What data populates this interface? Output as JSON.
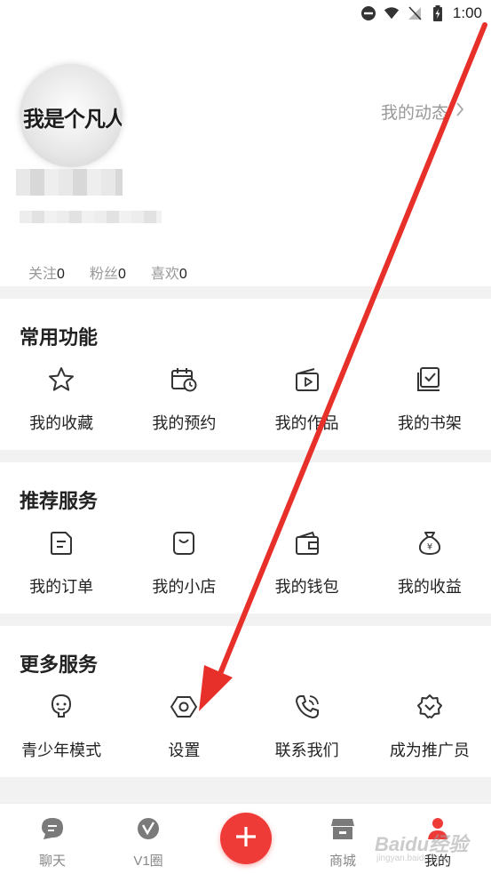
{
  "status_bar": {
    "time": "1:00"
  },
  "profile": {
    "avatar_text": "我是个凡人",
    "dynamics_link": "我的动态",
    "stats": [
      {
        "label": "关注",
        "value": "0"
      },
      {
        "label": "粉丝",
        "value": "0"
      },
      {
        "label": "喜欢",
        "value": "0"
      }
    ]
  },
  "sections": {
    "common": {
      "title": "常用功能",
      "items": [
        {
          "label": "我的收藏",
          "icon": "star-icon"
        },
        {
          "label": "我的预约",
          "icon": "calendar-clock-icon"
        },
        {
          "label": "我的作品",
          "icon": "video-folder-icon"
        },
        {
          "label": "我的书架",
          "icon": "bookshelf-icon"
        }
      ]
    },
    "recommended": {
      "title": "推荐服务",
      "items": [
        {
          "label": "我的订单",
          "icon": "order-icon"
        },
        {
          "label": "我的小店",
          "icon": "shop-bag-icon"
        },
        {
          "label": "我的钱包",
          "icon": "wallet-icon"
        },
        {
          "label": "我的收益",
          "icon": "money-bag-icon"
        }
      ]
    },
    "more": {
      "title": "更多服务",
      "items": [
        {
          "label": "青少年模式",
          "icon": "youth-mode-icon"
        },
        {
          "label": "设置",
          "icon": "settings-hexagon-icon"
        },
        {
          "label": "联系我们",
          "icon": "phone-call-icon"
        },
        {
          "label": "成为推广员",
          "icon": "promoter-badge-icon"
        }
      ]
    }
  },
  "tabbar": {
    "tabs": [
      {
        "label": "聊天",
        "icon": "chat-icon"
      },
      {
        "label": "V1圈",
        "icon": "v1-circle-icon"
      },
      {
        "label": "商城",
        "icon": "store-icon"
      },
      {
        "label": "我的",
        "icon": "profile-icon",
        "active": true
      }
    ],
    "plus_icon": "plus-icon",
    "watermark": "Baidu经验",
    "watermark_sub": "jingyan.baidu.com"
  },
  "colors": {
    "accent": "#ef3b38",
    "arrow": "#e8302b",
    "section_gap": "#f2f2f2"
  }
}
